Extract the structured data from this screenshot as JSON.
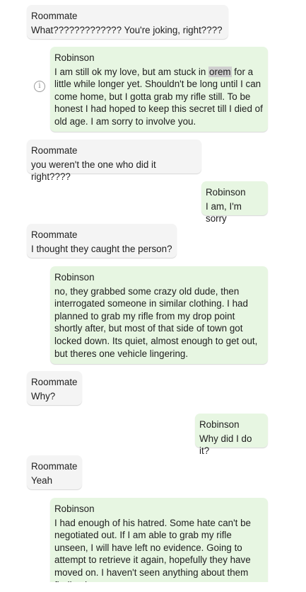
{
  "messages": [
    {
      "sender": "Roommate",
      "text": "What????????????? You're joking, right????"
    },
    {
      "sender": "Robinson",
      "text_before": "I am still ok my love, but am stuck in ",
      "highlight": "orem",
      "text_after": " for a little while longer yet. Shouldn't be long until I can come home, but I gotta grab my rifle still. To be honest I had hoped to keep this secret till I died of old age. I am sorry to involve you."
    },
    {
      "sender": "Roommate",
      "text": "you weren't the one who did it right????"
    },
    {
      "sender": "Robinson",
      "text": "I am, I'm sorry"
    },
    {
      "sender": "Roommate",
      "text": "I thought they caught the person?"
    },
    {
      "sender": "Robinson",
      "text": "no, they grabbed some crazy old dude, then interrogated someone in similar clothing. I had planned to grab my rifle from my drop point shortly after, but most of that side of town got locked down. Its quiet, almost enough to get out, but theres one vehicle lingering."
    },
    {
      "sender": "Roommate",
      "text": "Why?"
    },
    {
      "sender": "Robinson",
      "text": "Why did I do it?"
    },
    {
      "sender": "Roommate",
      "text": "Yeah"
    },
    {
      "sender": "Robinson",
      "text": "I had enough of his hatred. Some hate can't be negotiated out. If I am able to grab my rifle unseen, I will have left no evidence. Going to attempt to retrieve it again, hopefully they have moved on. I haven't seen anything about them finding it yet."
    }
  ],
  "info_icon": {
    "glyph": "i",
    "icon": "info-icon"
  }
}
